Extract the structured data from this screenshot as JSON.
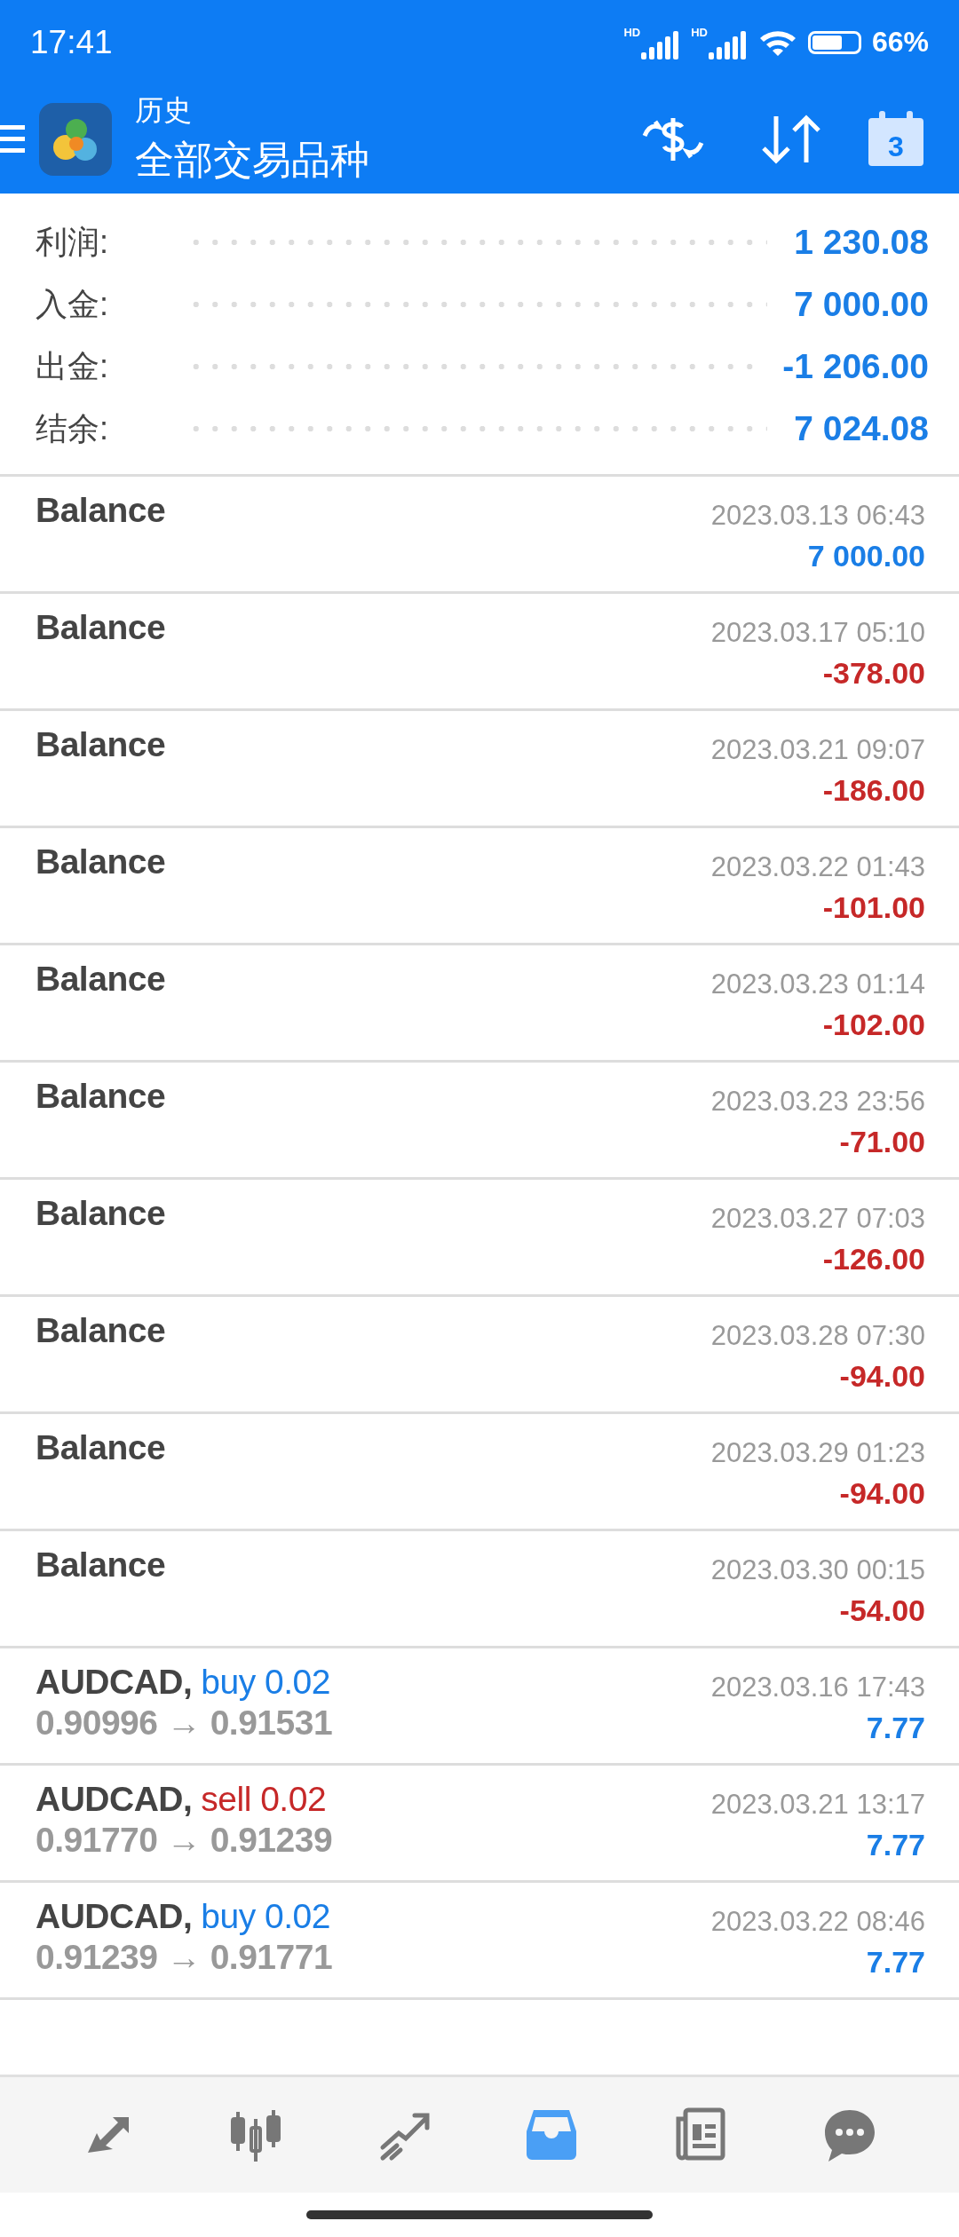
{
  "status_bar": {
    "time": "17:41",
    "signals": [
      {
        "label": "HD"
      },
      {
        "label": "HD"
      }
    ],
    "battery": "66%"
  },
  "header": {
    "title": "历史",
    "subtitle": "全部交易品种",
    "calendar_day": "3"
  },
  "summary": [
    {
      "label": "利润:",
      "value": "1 230.08"
    },
    {
      "label": "入金:",
      "value": "7 000.00"
    },
    {
      "label": "出金:",
      "value": "-1 206.00"
    },
    {
      "label": "结余:",
      "value": "7 024.08"
    }
  ],
  "deals": [
    {
      "kind": "balance",
      "title": "Balance",
      "time": "2023.03.13 06:43",
      "amount": "7 000.00",
      "positive": true
    },
    {
      "kind": "balance",
      "title": "Balance",
      "time": "2023.03.17 05:10",
      "amount": "-378.00",
      "positive": false
    },
    {
      "kind": "balance",
      "title": "Balance",
      "time": "2023.03.21 09:07",
      "amount": "-186.00",
      "positive": false
    },
    {
      "kind": "balance",
      "title": "Balance",
      "time": "2023.03.22 01:43",
      "amount": "-101.00",
      "positive": false
    },
    {
      "kind": "balance",
      "title": "Balance",
      "time": "2023.03.23 01:14",
      "amount": "-102.00",
      "positive": false
    },
    {
      "kind": "balance",
      "title": "Balance",
      "time": "2023.03.23 23:56",
      "amount": "-71.00",
      "positive": false
    },
    {
      "kind": "balance",
      "title": "Balance",
      "time": "2023.03.27 07:03",
      "amount": "-126.00",
      "positive": false
    },
    {
      "kind": "balance",
      "title": "Balance",
      "time": "2023.03.28 07:30",
      "amount": "-94.00",
      "positive": false
    },
    {
      "kind": "balance",
      "title": "Balance",
      "time": "2023.03.29 01:23",
      "amount": "-94.00",
      "positive": false
    },
    {
      "kind": "balance",
      "title": "Balance",
      "time": "2023.03.30 00:15",
      "amount": "-54.00",
      "positive": false
    },
    {
      "kind": "trade",
      "title": "AUDCAD,",
      "color": "#1a7ee6",
      "action": "buy 0.02",
      "prices": "0.90996 → 0.91531",
      "time": "2023.03.16 17:43",
      "amount": "7.77",
      "positive": true
    },
    {
      "kind": "trade",
      "title": "AUDCAD,",
      "color": "#c62828",
      "action": "sell 0.02",
      "prices": "0.91770 → 0.91239",
      "time": "2023.03.21 13:17",
      "amount": "7.77",
      "positive": true
    },
    {
      "kind": "trade",
      "title": "AUDCAD,",
      "color": "#1a7ee6",
      "action": "buy 0.02",
      "prices": "0.91239 → 0.91771",
      "time": "2023.03.22 08:46",
      "amount": "7.77",
      "positive": true
    }
  ],
  "bottom_nav": [
    {
      "selected": false
    },
    {
      "selected": false
    },
    {
      "selected": false
    },
    {
      "selected": true
    },
    {
      "selected": false
    },
    {
      "selected": false
    }
  ]
}
